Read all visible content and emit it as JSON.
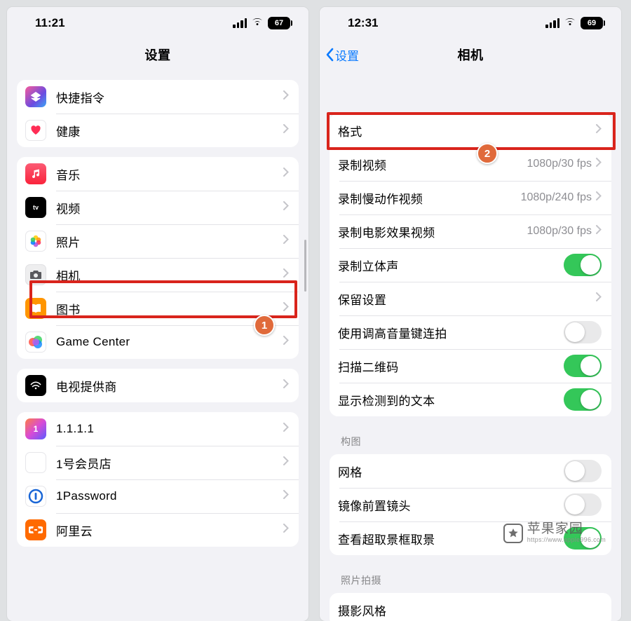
{
  "colors": {
    "accent": "#0a7aff",
    "switch_on": "#34c759",
    "highlight": "#d9241c",
    "badge": "#e06a3b"
  },
  "annotations": {
    "step1": "1",
    "step2": "2"
  },
  "watermark": {
    "brand": "苹果家园",
    "url": "https://www.apple996.com"
  },
  "phone1": {
    "status": {
      "time": "11:21",
      "battery": "67"
    },
    "title": "设置",
    "g1": [
      {
        "id": "shortcuts",
        "label": "快捷指令"
      },
      {
        "id": "health",
        "label": "健康"
      }
    ],
    "g2": [
      {
        "id": "music",
        "label": "音乐"
      },
      {
        "id": "tv",
        "label": "视频"
      },
      {
        "id": "photos",
        "label": "照片"
      },
      {
        "id": "camera",
        "label": "相机"
      },
      {
        "id": "books",
        "label": "图书"
      },
      {
        "id": "gc",
        "label": "Game Center"
      }
    ],
    "g3": [
      {
        "id": "tvprov",
        "label": "电视提供商"
      }
    ],
    "g4": [
      {
        "id": "1111",
        "label": "1.1.1.1"
      },
      {
        "id": "1hao",
        "label": "1号会员店"
      },
      {
        "id": "1pass",
        "label": "1Password"
      },
      {
        "id": "aliyun",
        "label": "阿里云"
      }
    ]
  },
  "phone2": {
    "status": {
      "time": "12:31",
      "battery": "69"
    },
    "back": "设置",
    "title": "相机",
    "g1": [
      {
        "id": "formats",
        "label": "格式",
        "type": "nav"
      },
      {
        "id": "rec_video",
        "label": "录制视频",
        "type": "nav",
        "value": "1080p/30 fps"
      },
      {
        "id": "rec_slomo",
        "label": "录制慢动作视频",
        "type": "nav",
        "value": "1080p/240 fps"
      },
      {
        "id": "rec_cinematic",
        "label": "录制电影效果视频",
        "type": "nav",
        "value": "1080p/30 fps"
      },
      {
        "id": "rec_stereo",
        "label": "录制立体声",
        "type": "switch",
        "on": true
      },
      {
        "id": "preserve",
        "label": "保留设置",
        "type": "nav"
      },
      {
        "id": "vol_burst",
        "label": "使用调高音量键连拍",
        "type": "switch",
        "on": false
      },
      {
        "id": "scan_qr",
        "label": "扫描二维码",
        "type": "switch",
        "on": true
      },
      {
        "id": "detected_text",
        "label": "显示检测到的文本",
        "type": "switch",
        "on": true
      }
    ],
    "sec_composition": "构图",
    "g2": [
      {
        "id": "grid",
        "label": "网格",
        "type": "switch",
        "on": false
      },
      {
        "id": "mirror_front",
        "label": "镜像前置镜头",
        "type": "switch",
        "on": false
      },
      {
        "id": "view_outside",
        "label": "查看超取景框取景",
        "type": "switch",
        "on": true
      }
    ],
    "sec_capture": "照片拍摄",
    "g3_peek": "摄影风格"
  }
}
